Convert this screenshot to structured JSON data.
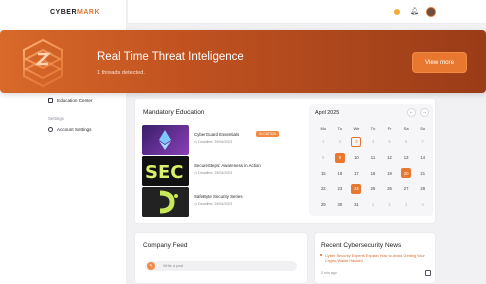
{
  "app": {
    "logo_prefix": "CYBER",
    "logo_suffix": "MARK"
  },
  "sidebar": {
    "items": [
      {
        "label": "Education Center",
        "icon": "book-icon"
      },
      {
        "label": "Account Settings",
        "icon": "user-settings-icon"
      }
    ],
    "section_settings": "Settings"
  },
  "header": {
    "icons": [
      "sun-icon",
      "bell-icon",
      "avatar"
    ]
  },
  "banner": {
    "title": "Real Time Threat Inteligence",
    "subtitle": "1 threads detected.",
    "button_label": "View more",
    "accent": "#e8782f"
  },
  "education": {
    "title": "Mandatory Education",
    "courses": [
      {
        "name": "CyberGuard Essentials",
        "deadline": "Deadline: 29/04/2023",
        "badge": "IN CATION"
      },
      {
        "name": "SecureSteps: Awareness in Action",
        "deadline": "Deadline: 29/04/2023",
        "badge": ""
      },
      {
        "name": "SafeByte Security Series",
        "deadline": "Deadline: 29/04/2023",
        "badge": ""
      }
    ]
  },
  "calendar": {
    "title": "April 2025",
    "prev": "←",
    "next": "→",
    "weekdays": [
      "Mo",
      "Tu",
      "We",
      "Th",
      "Fr",
      "Sa",
      "Su"
    ],
    "days": [
      {
        "d": "1",
        "muted": true
      },
      {
        "d": "2",
        "muted": true
      },
      {
        "d": "3",
        "today": true
      },
      {
        "d": "4",
        "muted": true
      },
      {
        "d": "5",
        "muted": true
      },
      {
        "d": "6",
        "muted": true
      },
      {
        "d": "7",
        "muted": true
      },
      {
        "d": "8",
        "muted": true
      },
      {
        "d": "9",
        "mark": true
      },
      {
        "d": "10"
      },
      {
        "d": "11"
      },
      {
        "d": "12"
      },
      {
        "d": "13"
      },
      {
        "d": "14"
      },
      {
        "d": "15"
      },
      {
        "d": "16"
      },
      {
        "d": "17"
      },
      {
        "d": "18"
      },
      {
        "d": "19"
      },
      {
        "d": "20",
        "mark": true
      },
      {
        "d": "21"
      },
      {
        "d": "22"
      },
      {
        "d": "23"
      },
      {
        "d": "24",
        "mark": true
      },
      {
        "d": "25"
      },
      {
        "d": "26"
      },
      {
        "d": "27"
      },
      {
        "d": "28"
      },
      {
        "d": "29"
      },
      {
        "d": "30"
      },
      {
        "d": "31"
      },
      {
        "d": "1",
        "muted": true
      },
      {
        "d": "2",
        "muted": true
      },
      {
        "d": "3",
        "muted": true
      },
      {
        "d": "4",
        "muted": true
      }
    ]
  },
  "feed": {
    "title": "Company Feed",
    "post_placeholder": "Write a post"
  },
  "news": {
    "title": "Recent Cybersecurity News",
    "headline": "Cyber Security Experts Explain How to Avoid Getting Your Crypto Wallet Hacked",
    "time": "2 min ago"
  }
}
